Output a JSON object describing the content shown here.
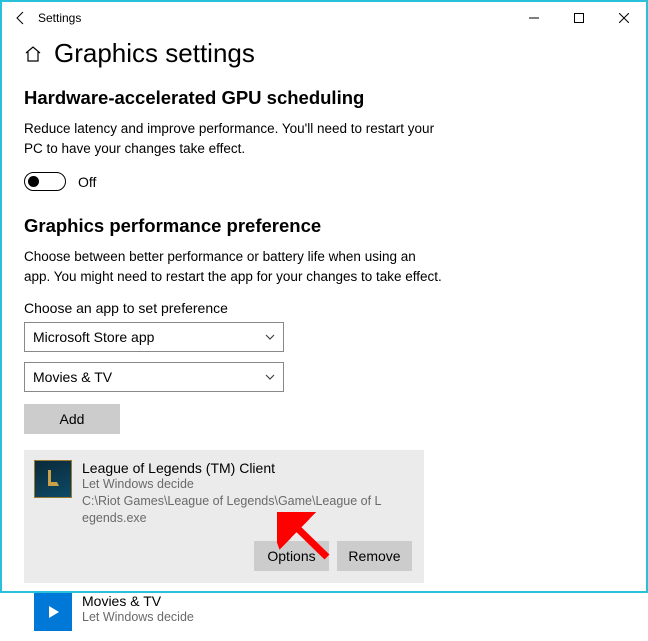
{
  "window": {
    "title": "Settings"
  },
  "page": {
    "title": "Graphics settings"
  },
  "section1": {
    "heading": "Hardware-accelerated GPU scheduling",
    "desc": "Reduce latency and improve performance. You'll need to restart your PC to have your changes take effect.",
    "toggle_state": "Off"
  },
  "section2": {
    "heading": "Graphics performance preference",
    "desc": "Choose between better performance or battery life when using an app. You might need to restart the app for your changes to take effect.",
    "choose_label": "Choose an app to set preference",
    "app_type_value": "Microsoft Store app",
    "app_select_value": "Movies & TV",
    "add_label": "Add"
  },
  "apps": [
    {
      "name": "League of Legends (TM) Client",
      "subtitle": "Let Windows decide",
      "path": "C:\\Riot Games\\League of Legends\\Game\\League of Legends.exe",
      "selected": true
    },
    {
      "name": "Movies & TV",
      "subtitle": "Let Windows decide",
      "selected": false
    }
  ],
  "buttons": {
    "options": "Options",
    "remove": "Remove"
  }
}
